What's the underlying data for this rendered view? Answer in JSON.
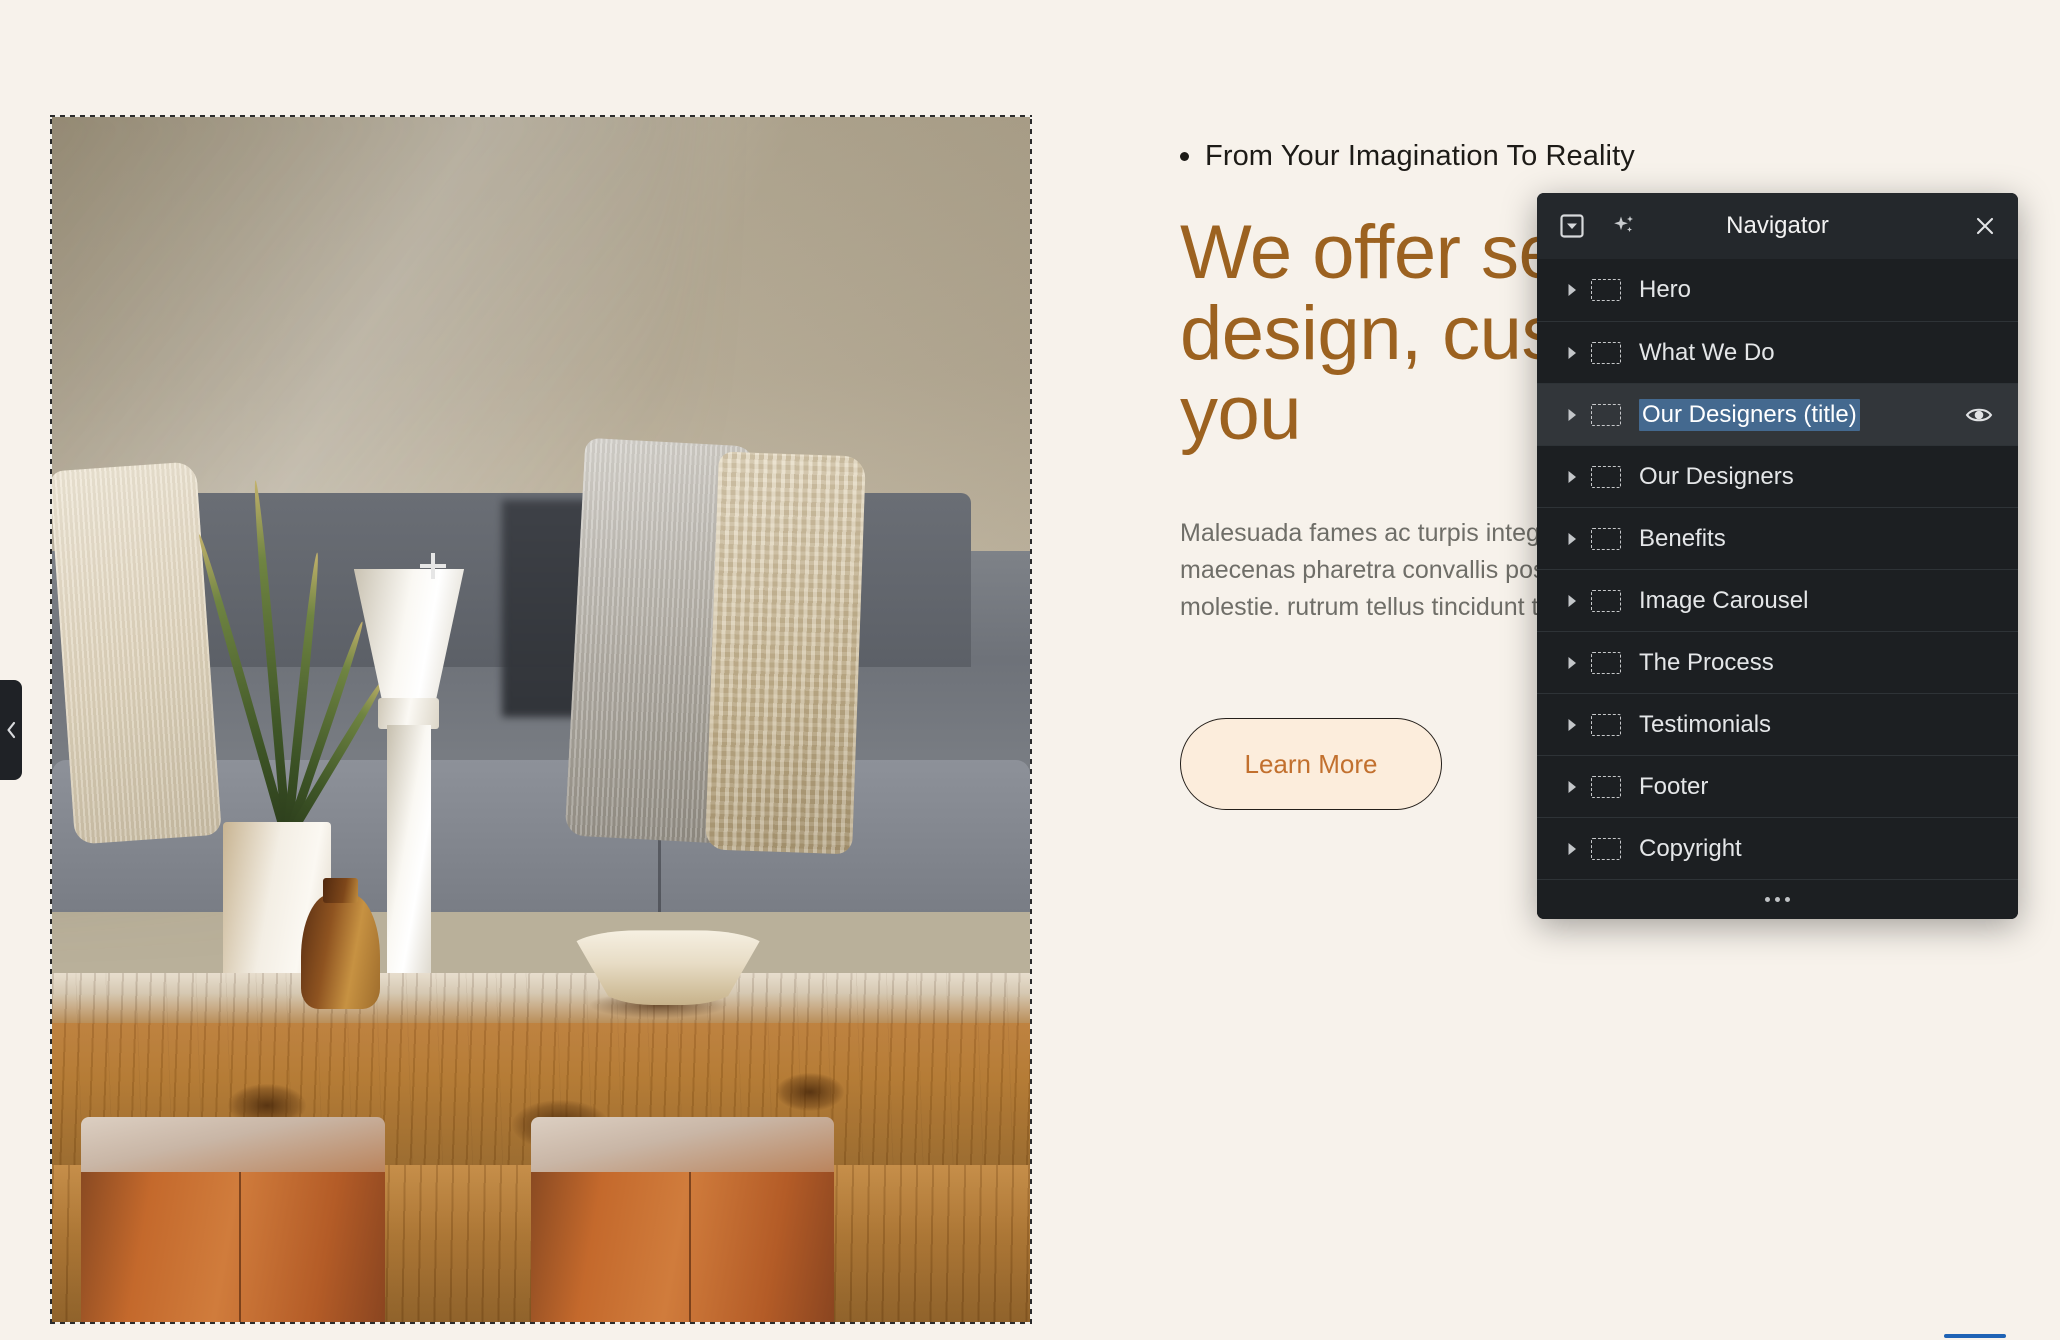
{
  "theme": {
    "page_bg": "#F7F2EB",
    "heading_color": "#9C6220",
    "body_text_color": "#6F6E68",
    "button_bg": "#FCEDDC",
    "button_text": "#C2702E",
    "panel_bg": "#1C1F22",
    "panel_header_bg": "#24282C",
    "selection_highlight": "#44698F",
    "row_selected_bg": "#32363A",
    "blue_bar": "#1F63B5"
  },
  "canvas": {
    "hero_image": {
      "alt": "Modern living room with gray sofa, textured pillows, snake plant, white pedestal vase, wooden coffee table and two tan leather ottomans",
      "selected": true,
      "crosshair_icon": "plus-crosshair-icon"
    },
    "text_block": {
      "eyebrow": "From Your Imagination To Reality",
      "headline": "We offer service in design, customize you",
      "body": "Malesuada fames ac turpis integer eget aliquet nibh maecenas pharetra convallis posuere morbi leo urna molestie.\nrutrum tellus tincidunt tortor aliquam nulla facilisi.",
      "cta_label": "Learn More"
    }
  },
  "left_tab": {
    "icon": "chevron-left-icon"
  },
  "navigator": {
    "title": "Navigator",
    "header_icons": {
      "collapse_all": "boxed-chevron-down-icon",
      "ai": "sparkles-icon",
      "close": "close-icon"
    },
    "footer_icon": "ellipsis-icon",
    "items": [
      {
        "label": "Hero",
        "selected": false,
        "eye": false
      },
      {
        "label": "What We Do",
        "selected": false,
        "eye": false
      },
      {
        "label": "Our Designers (title)",
        "selected": true,
        "eye": true
      },
      {
        "label": "Our Designers",
        "selected": false,
        "eye": false
      },
      {
        "label": "Benefits",
        "selected": false,
        "eye": false
      },
      {
        "label": "Image Carousel",
        "selected": false,
        "eye": false
      },
      {
        "label": "The Process",
        "selected": false,
        "eye": false
      },
      {
        "label": "Testimonials",
        "selected": false,
        "eye": false
      },
      {
        "label": "Footer",
        "selected": false,
        "eye": false
      },
      {
        "label": "Copyright",
        "selected": false,
        "eye": false
      }
    ]
  }
}
